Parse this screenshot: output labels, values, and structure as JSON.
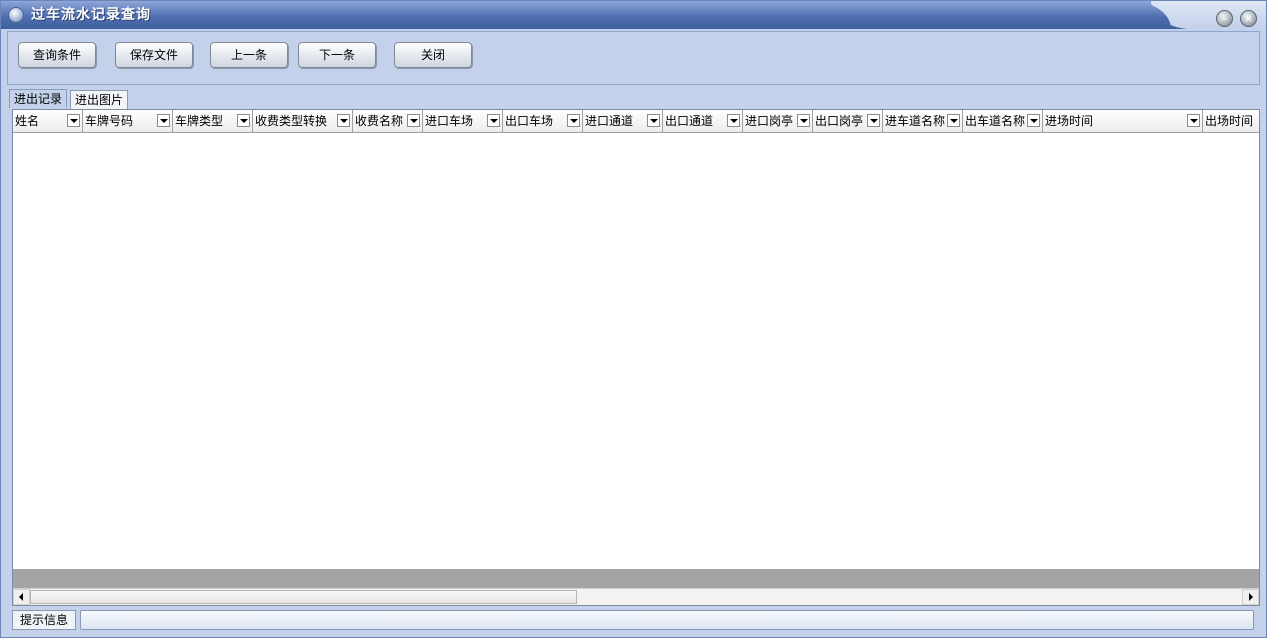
{
  "window": {
    "title": "过车流水记录查询"
  },
  "toolbar": {
    "buttons": [
      {
        "label": "查询条件"
      },
      {
        "label": "保存文件"
      },
      {
        "label": "上一条"
      },
      {
        "label": "下一条"
      },
      {
        "label": "关闭"
      }
    ]
  },
  "tabs": [
    {
      "label": "进出记录",
      "active": true
    },
    {
      "label": "进出图片",
      "active": false
    }
  ],
  "grid": {
    "columns": [
      {
        "label": "姓名"
      },
      {
        "label": "车牌号码"
      },
      {
        "label": "车牌类型"
      },
      {
        "label": "收费类型转换"
      },
      {
        "label": "收费名称"
      },
      {
        "label": "进口车场"
      },
      {
        "label": "出口车场"
      },
      {
        "label": "进口通道"
      },
      {
        "label": "出口通道"
      },
      {
        "label": "进口岗亭"
      },
      {
        "label": "出口岗亭"
      },
      {
        "label": "进车道名称"
      },
      {
        "label": "出车道名称"
      },
      {
        "label": "进场时间"
      },
      {
        "label": "出场时间"
      }
    ],
    "rows": []
  },
  "statusbar": {
    "label": "提示信息",
    "message": ""
  }
}
